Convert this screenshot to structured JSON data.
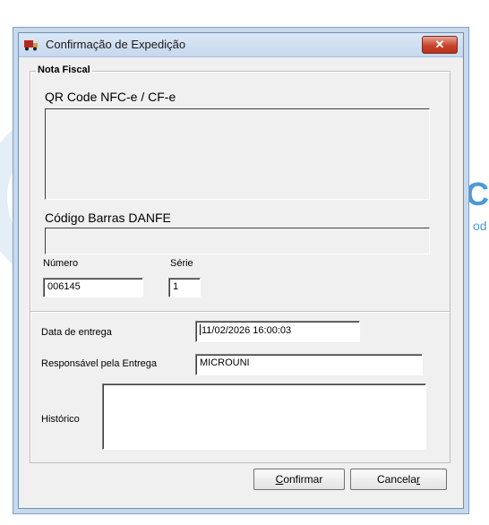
{
  "watermark": {
    "letter": "C",
    "small_text": "od"
  },
  "window": {
    "title": "Confirmação de Expedição",
    "close_glyph": "✕"
  },
  "nota_fiscal": {
    "group_label": "Nota Fiscal",
    "qr_label": "QR Code NFC-e / CF-e",
    "barcode_label": "Código Barras DANFE",
    "numero_label": "Número",
    "numero_value": "006145",
    "serie_label": "Série",
    "serie_value": "1"
  },
  "delivery": {
    "data_label": "Data de entrega",
    "data_value": "11/02/2026 16:00:03",
    "responsavel_label": "Responsável pela Entrega",
    "responsavel_value": "MICROUNI",
    "historico_label": "Histórico",
    "historico_value": ""
  },
  "buttons": {
    "confirm_first": "C",
    "confirm_rest": "onfirmar",
    "cancel_main": "Cancela",
    "cancel_underlined": "r"
  },
  "icons": {
    "app": "truck-icon",
    "close": "close-icon"
  },
  "colors": {
    "titlebar": "#c7d8ee",
    "close": "#c8432c",
    "dialog_bg": "#f0f0f0"
  }
}
